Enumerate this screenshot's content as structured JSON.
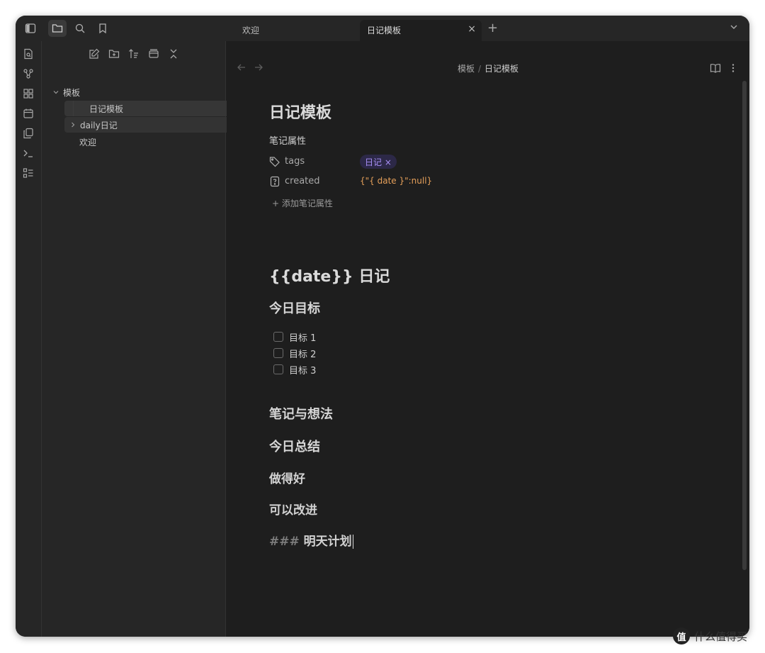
{
  "tabs": [
    {
      "label": "欢迎",
      "active": false
    },
    {
      "label": "日记模板",
      "active": true
    }
  ],
  "tab_close": "×",
  "tab_new": "+",
  "file_tree": {
    "folder_templates": "模板",
    "file_diary_template": "日记模板",
    "folder_daily": "daily日记",
    "file_welcome": "欢迎"
  },
  "breadcrumb": {
    "parent": "模板",
    "separator": "/",
    "current": "日记模板"
  },
  "note": {
    "title": "日记模板",
    "properties_label": "笔记属性",
    "properties": [
      {
        "key": "tags",
        "value": "日记",
        "icon": "tag-icon"
      },
      {
        "key": "created",
        "value": "{\"{ date }\":null}",
        "icon": "question-file-icon"
      }
    ],
    "tag_remove": "×",
    "add_property": "+ 添加笔记属性",
    "heading_date": "{{date}} 日记",
    "heading_goals": "今日目标",
    "tasks": [
      "目标 1",
      "目标 2",
      "目标 3"
    ],
    "heading_notes": "笔记与想法",
    "heading_summary": "今日总结",
    "heading_good": "做得好",
    "heading_improve": "可以改进",
    "raw_heading_prefix": "###",
    "raw_heading_text": "明天计划"
  },
  "colors": {
    "accent_purple": "#a990f7",
    "property_orange": "#e6a05a",
    "background": "#1e1e1e"
  },
  "watermark": {
    "logo": "值",
    "text": "什么值得买"
  }
}
